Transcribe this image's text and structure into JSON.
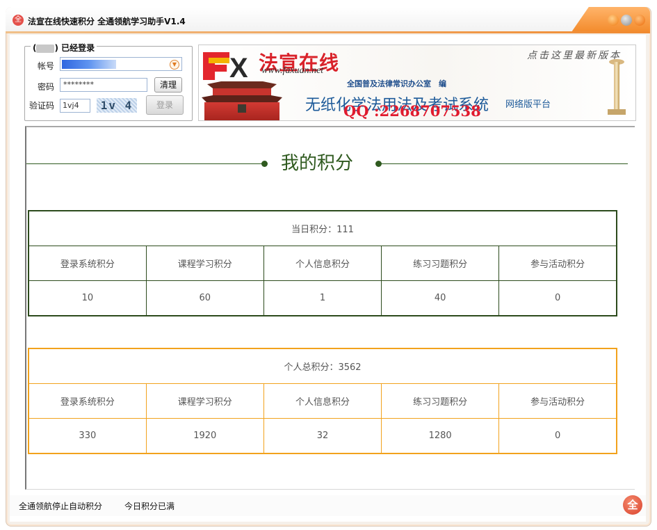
{
  "window": {
    "title": "法宣在线快速积分 全通领航学习助手V1.4",
    "icon": "app-logo-icon"
  },
  "login": {
    "legend_prefix": "(",
    "legend_suffix": ")",
    "status_label": "已经登录",
    "account_label": "帐号",
    "password_label": "密码",
    "password_value": "********",
    "clear_button": "清理",
    "captcha_label": "验证码",
    "captcha_value": "1vj4",
    "captcha_image_text": "1v 4",
    "login_button": "登录"
  },
  "banner": {
    "fx_letters": "X",
    "brand": "法宣在线",
    "url": "www.faxuan.net",
    "latest_version_link": "点击这里最新版本",
    "office": "全国普及法律常识办公室　编",
    "system_name": "无纸化学法用法及考试系统",
    "qq": "QQ :2268707538",
    "network_edition": "网络版平台"
  },
  "main": {
    "title": "我的积分",
    "daily": {
      "header": "当日积分：111",
      "columns": [
        "登录系统积分",
        "课程学习积分",
        "个人信息积分",
        "练习习题积分",
        "参与活动积分"
      ],
      "values": [
        "10",
        "60",
        "1",
        "40",
        "0"
      ]
    },
    "total": {
      "header": "个人总积分：3562",
      "columns": [
        "登录系统积分",
        "课程学习积分",
        "个人信息积分",
        "练习习题积分",
        "参与活动积分"
      ],
      "values": [
        "330",
        "1920",
        "32",
        "1280",
        "0"
      ]
    }
  },
  "status": {
    "message1": "全通领航停止自动积分",
    "message2": "今日积分已满",
    "icon_glyph": "全"
  },
  "colors": {
    "accent_orange": "#f08a30",
    "daily_border": "#2c4a1c",
    "total_border": "#f2a21c",
    "brand_red": "#d9222a",
    "system_blue": "#1d5a99"
  }
}
